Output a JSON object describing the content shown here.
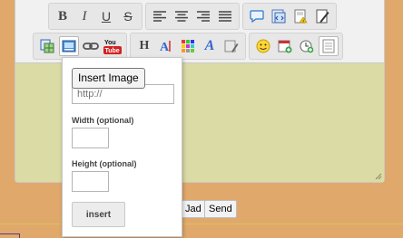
{
  "toolbar": {
    "row1": {
      "format": [
        "B",
        "I",
        "U",
        "S"
      ],
      "align": [
        "align-left-icon",
        "align-center-icon",
        "align-right-icon",
        "align-justify-icon"
      ],
      "misc": [
        "speech-bubble-icon",
        "code-icon",
        "document-warning-icon",
        "pen-document-icon"
      ]
    },
    "row2": {
      "media": [
        "insert-table-icon",
        "insert-image-icon",
        "insert-link-icon",
        "youtube-icon"
      ],
      "youtube": {
        "you": "You",
        "tube": "Tube"
      },
      "text_tools": [
        "H",
        "font-icon",
        "color-palette-icon",
        "A",
        "clear-formatting-icon"
      ],
      "extras": [
        "smiley-icon",
        "calendar-icon",
        "clock-icon",
        "source-document-icon"
      ]
    }
  },
  "popup": {
    "tooltip": "Insert Image",
    "url_placeholder": "http://",
    "width_label": "Width (optional)",
    "height_label": "Height (optional)",
    "insert_label": "insert"
  },
  "bottom_buttons": {
    "upload_label": "Jad",
    "send_label": "Send"
  },
  "colors": {
    "background": "#e1a86c",
    "editor_area": "#dadba5",
    "toolbar": "#f1f1f1"
  }
}
